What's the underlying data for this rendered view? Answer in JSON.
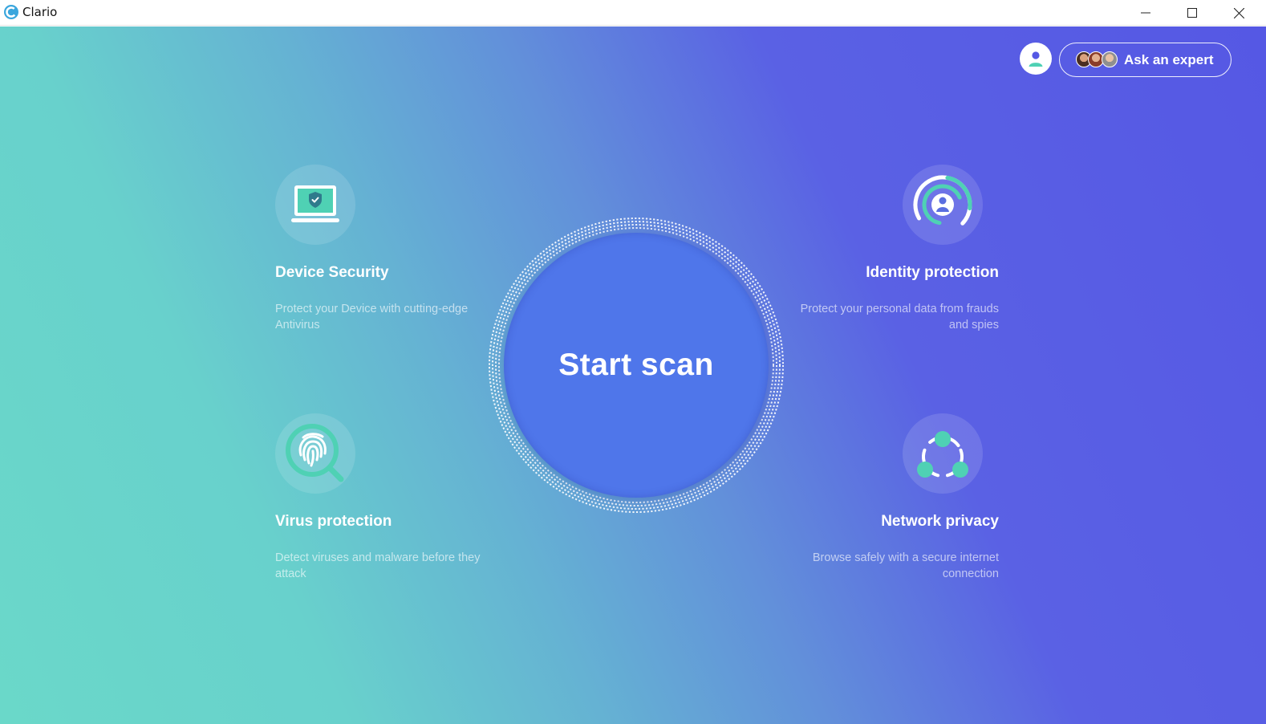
{
  "window": {
    "title": "Clario",
    "controls": {
      "minimize_icon": "minimize-icon",
      "maximize_icon": "maximize-icon",
      "close_icon": "close-icon"
    }
  },
  "header": {
    "account_icon": "user-icon",
    "ask_expert": {
      "label": "Ask an expert",
      "avatars": 3
    }
  },
  "scan": {
    "label": "Start scan"
  },
  "features": [
    {
      "id": "device-security",
      "title": "Device Security",
      "description": "Protect your Device with cutting-edge Antivirus",
      "icon": "laptop-shield-icon"
    },
    {
      "id": "identity-protection",
      "title": "Identity protection",
      "description": "Protect your personal data from frauds and spies",
      "icon": "identity-target-icon"
    },
    {
      "id": "virus-protection",
      "title": "Virus protection",
      "description": "Detect viruses and malware before they attack",
      "icon": "fingerprint-magnifier-icon"
    },
    {
      "id": "network-privacy",
      "title": "Network privacy",
      "description": "Browse safely with a secure internet connection",
      "icon": "network-nodes-icon"
    }
  ],
  "colors": {
    "accent_teal": "#4fd1b4",
    "scan_blue": "#4f76ea",
    "gradient_purple": "#5558e4",
    "gradient_teal": "#6ad8c9"
  }
}
